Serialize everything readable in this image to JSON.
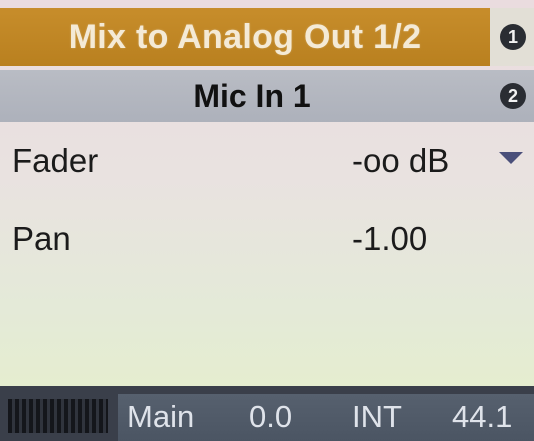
{
  "header": {
    "title": "Mix to Analog Out 1/2",
    "badge": "1",
    "color": "#c78d2b"
  },
  "subheader": {
    "title": "Mic In 1",
    "badge": "2",
    "color": "#b5b8c0"
  },
  "params": [
    {
      "label": "Fader",
      "value": "-oo dB",
      "has_dropdown": true
    },
    {
      "label": "Pan",
      "value": "-1.00"
    }
  ],
  "status_bar": {
    "mix": "Main",
    "level": "0.0",
    "clock": "INT",
    "sample_rate": "44.1"
  }
}
